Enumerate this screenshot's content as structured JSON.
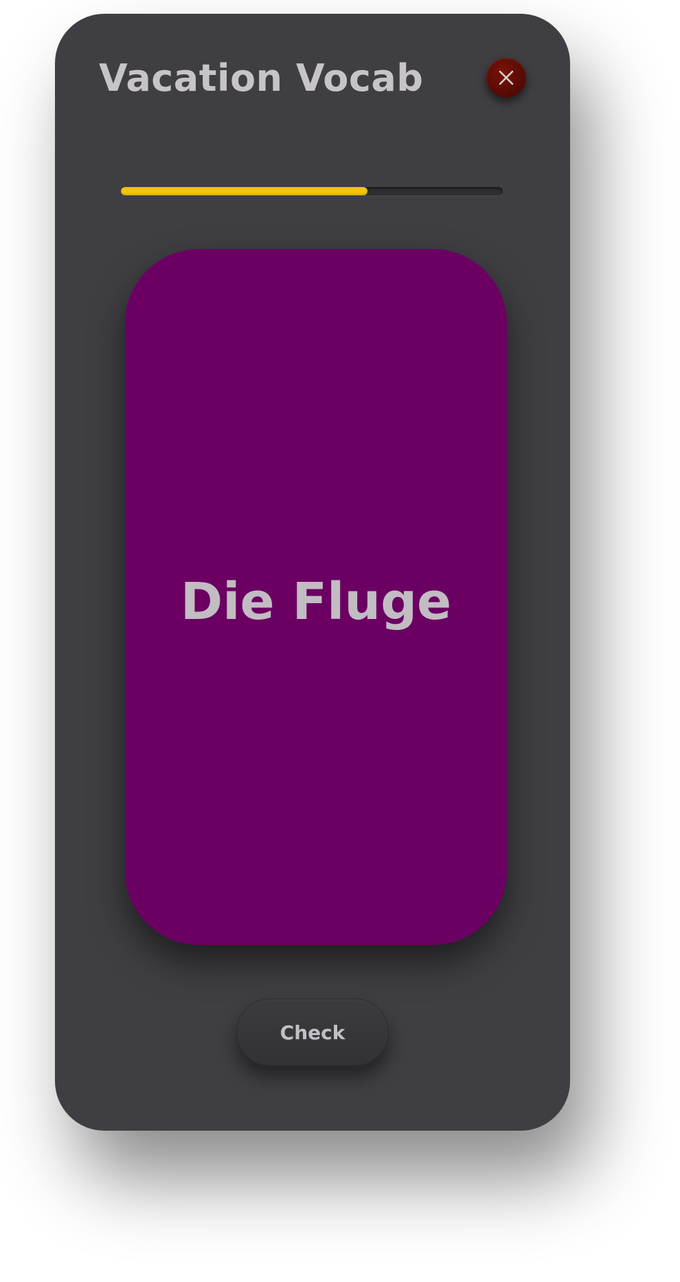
{
  "header": {
    "title": "Vacation Vocab",
    "close_icon": "close-icon"
  },
  "progress": {
    "fraction": 0.645,
    "color": "#f2c40e"
  },
  "flashcard": {
    "word": "Die Fluge",
    "color": "#6b0062"
  },
  "actions": {
    "check_label": "Check"
  },
  "colors": {
    "window_background": "#3f3e42",
    "close_button": "#5a0c05",
    "text": "#c7c4c9"
  }
}
